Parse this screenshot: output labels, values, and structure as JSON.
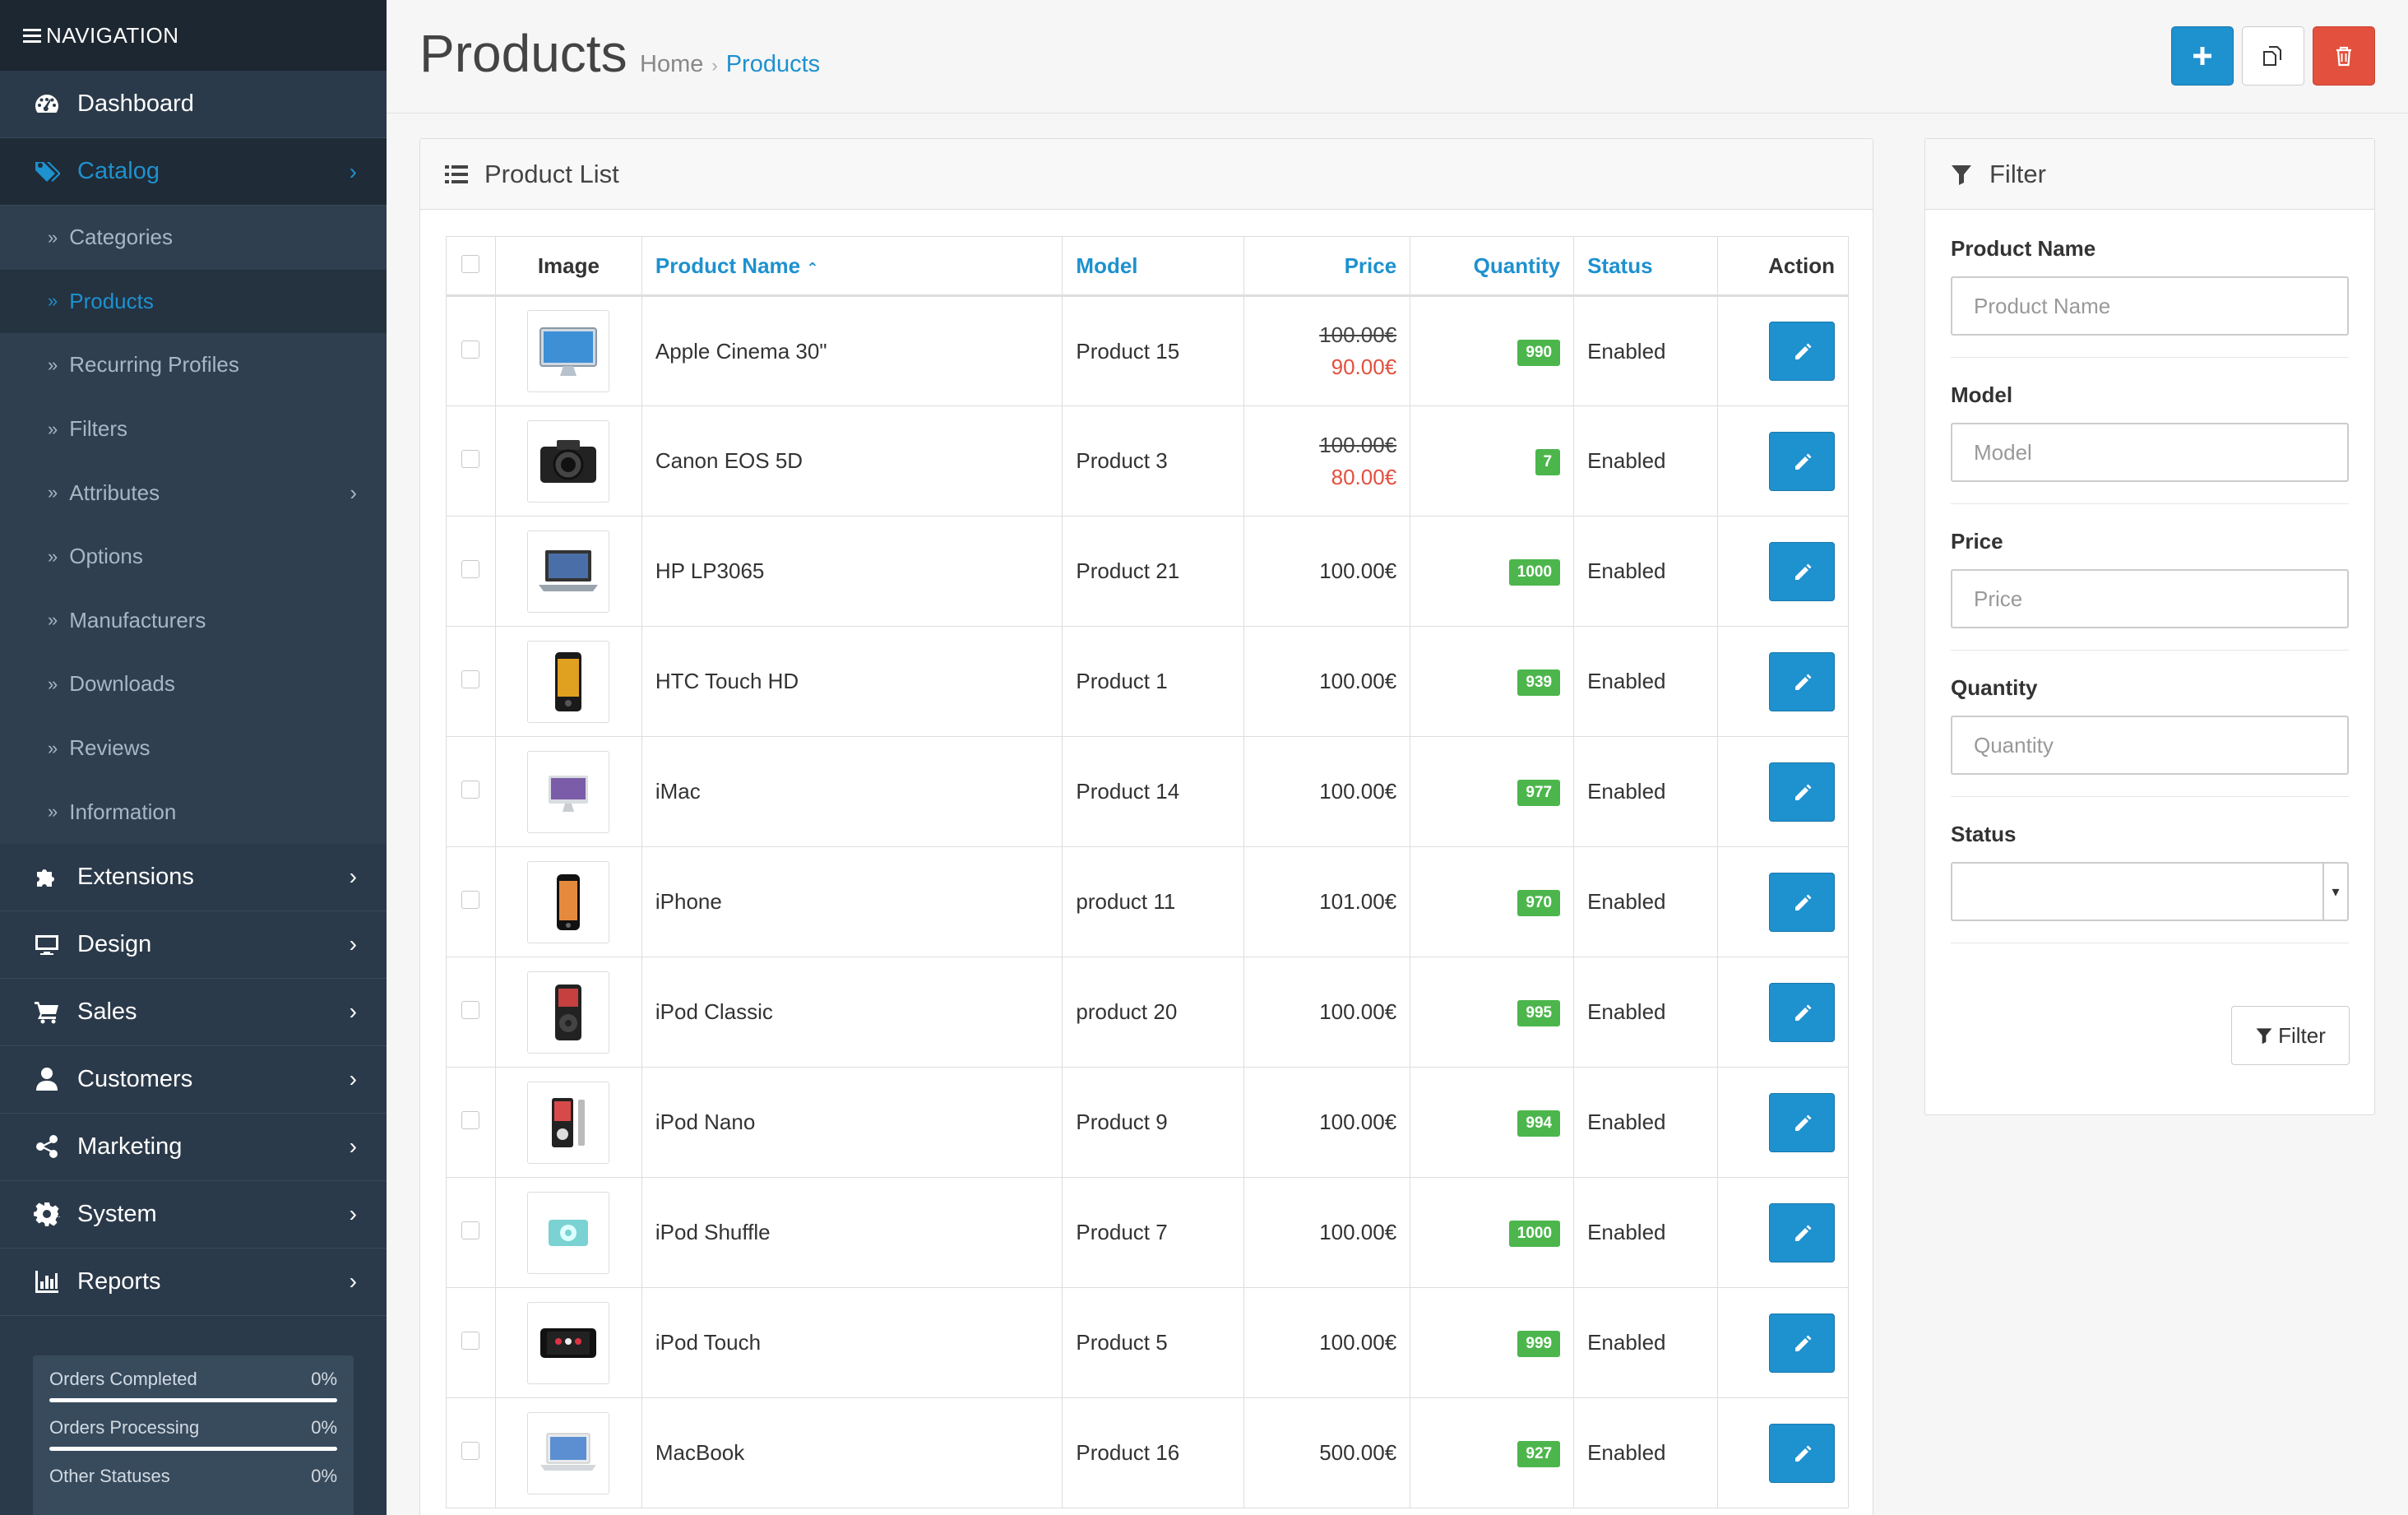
{
  "sidebar": {
    "title": "NAVIGATION",
    "menu_top": [
      {
        "label": "Dashboard",
        "icon": "dashboard-icon"
      },
      {
        "label": "Catalog",
        "icon": "tags-icon",
        "active": true
      }
    ],
    "catalog_sub": [
      {
        "label": "Categories"
      },
      {
        "label": "Products",
        "active": true
      },
      {
        "label": "Recurring Profiles"
      },
      {
        "label": "Filters"
      },
      {
        "label": "Attributes",
        "has_children": true
      },
      {
        "label": "Options"
      },
      {
        "label": "Manufacturers"
      },
      {
        "label": "Downloads"
      },
      {
        "label": "Reviews"
      },
      {
        "label": "Information"
      }
    ],
    "menu_bottom": [
      {
        "label": "Extensions",
        "icon": "puzzle-icon"
      },
      {
        "label": "Design",
        "icon": "monitor-icon"
      },
      {
        "label": "Sales",
        "icon": "cart-icon"
      },
      {
        "label": "Customers",
        "icon": "user-icon"
      },
      {
        "label": "Marketing",
        "icon": "share-icon"
      },
      {
        "label": "System",
        "icon": "cog-icon"
      },
      {
        "label": "Reports",
        "icon": "bar-chart-icon"
      }
    ],
    "stats": [
      {
        "label": "Orders Completed",
        "value": "0%",
        "progress": 0
      },
      {
        "label": "Orders Processing",
        "value": "0%",
        "progress": 0
      },
      {
        "label": "Other Statuses",
        "value": "0%",
        "progress": 0
      }
    ]
  },
  "header": {
    "title": "Products",
    "breadcrumb": {
      "home": "Home",
      "current": "Products"
    },
    "buttons": {
      "add": "plus-icon",
      "copy": "copy-icon",
      "delete": "trash-icon"
    }
  },
  "product_list": {
    "title": "Product List",
    "columns": {
      "image": "Image",
      "name": "Product Name",
      "model": "Model",
      "price": "Price",
      "quantity": "Quantity",
      "status": "Status",
      "action": "Action"
    },
    "rows": [
      {
        "name": "Apple Cinema 30\"",
        "model": "Product 15",
        "price": "100.00€",
        "special": "90.00€",
        "quantity": "990",
        "status": "Enabled",
        "thumb": "monitor-thumb-icon"
      },
      {
        "name": "Canon EOS 5D",
        "model": "Product 3",
        "price": "100.00€",
        "special": "80.00€",
        "quantity": "7",
        "status": "Enabled",
        "thumb": "camera-thumb-icon"
      },
      {
        "name": "HP LP3065",
        "model": "Product 21",
        "price": "100.00€",
        "special": "",
        "quantity": "1000",
        "status": "Enabled",
        "thumb": "laptop-thumb-icon"
      },
      {
        "name": "HTC Touch HD",
        "model": "Product 1",
        "price": "100.00€",
        "special": "",
        "quantity": "939",
        "status": "Enabled",
        "thumb": "phone-thumb-icon"
      },
      {
        "name": "iMac",
        "model": "Product 14",
        "price": "100.00€",
        "special": "",
        "quantity": "977",
        "status": "Enabled",
        "thumb": "imac-thumb-icon"
      },
      {
        "name": "iPhone",
        "model": "product 11",
        "price": "101.00€",
        "special": "",
        "quantity": "970",
        "status": "Enabled",
        "thumb": "iphone-thumb-icon"
      },
      {
        "name": "iPod Classic",
        "model": "product 20",
        "price": "100.00€",
        "special": "",
        "quantity": "995",
        "status": "Enabled",
        "thumb": "ipod-classic-thumb-icon"
      },
      {
        "name": "iPod Nano",
        "model": "Product 9",
        "price": "100.00€",
        "special": "",
        "quantity": "994",
        "status": "Enabled",
        "thumb": "ipod-nano-thumb-icon"
      },
      {
        "name": "iPod Shuffle",
        "model": "Product 7",
        "price": "100.00€",
        "special": "",
        "quantity": "1000",
        "status": "Enabled",
        "thumb": "ipod-shuffle-thumb-icon"
      },
      {
        "name": "iPod Touch",
        "model": "Product 5",
        "price": "100.00€",
        "special": "",
        "quantity": "999",
        "status": "Enabled",
        "thumb": "ipod-touch-thumb-icon"
      },
      {
        "name": "MacBook",
        "model": "Product 16",
        "price": "500.00€",
        "special": "",
        "quantity": "927",
        "status": "Enabled",
        "thumb": "macbook-thumb-icon"
      }
    ]
  },
  "filter": {
    "title": "Filter",
    "fields": [
      {
        "label": "Product Name",
        "placeholder": "Product Name"
      },
      {
        "label": "Model",
        "placeholder": "Model"
      },
      {
        "label": "Price",
        "placeholder": "Price"
      },
      {
        "label": "Quantity",
        "placeholder": "Quantity"
      }
    ],
    "status_label": "Status",
    "status_value": "",
    "button_label": "Filter"
  },
  "colors": {
    "sidebar_bg": "#2b3a4a",
    "accent": "#1e91cf",
    "danger": "#e3503e",
    "success": "#4cb64c"
  }
}
